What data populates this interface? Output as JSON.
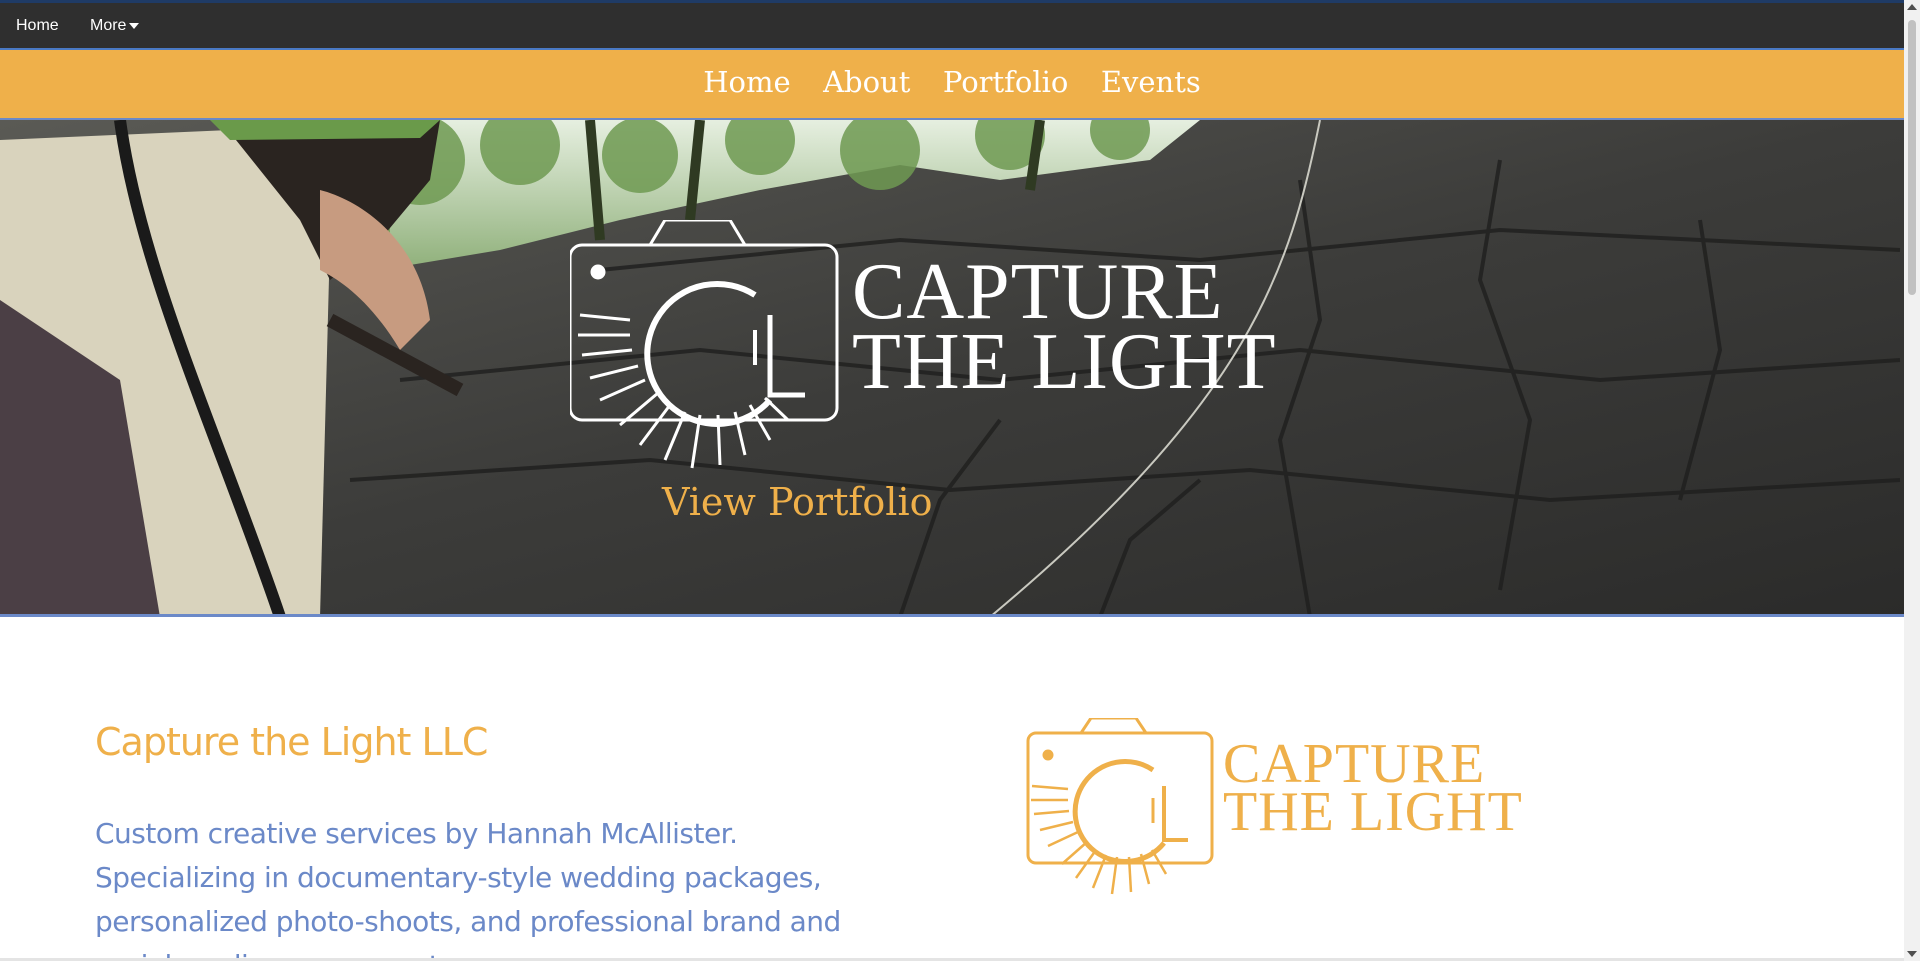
{
  "admin_bar": {
    "home_label": "Home",
    "more_label": "More"
  },
  "nav": {
    "links": [
      "Home",
      "About",
      "Portfolio",
      "Events"
    ]
  },
  "hero": {
    "logo_title_line1": "CAPTURE",
    "logo_title_line2": "THE LIGHT",
    "logo_monogram": "CTL",
    "cta_label": "View Portfolio"
  },
  "content": {
    "company_name": "Capture the Light LLC",
    "description": "Custom creative services by Hannah McAllister. Specializing in documentary-style wedding packages, personalized photo-shoots, and professional brand and social media managment.",
    "logo_title_line1": "CAPTURE",
    "logo_title_line2": "THE LIGHT"
  },
  "colors": {
    "accent_orange": "#efb04a",
    "accent_blue": "#6b89c8",
    "admin_bar_bg": "#2f2f2f"
  },
  "icons": {
    "more_caret": "caret-down-icon",
    "logo": "camera-sun-logo-icon"
  }
}
